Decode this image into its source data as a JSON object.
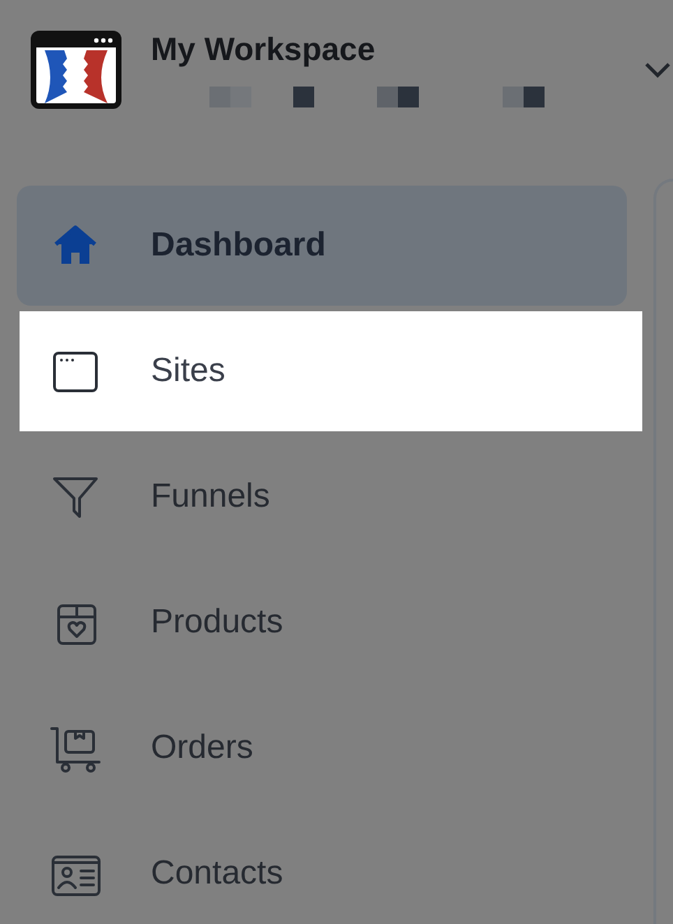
{
  "workspace": {
    "title": "My Workspace"
  },
  "nav": [
    {
      "label": "Dashboard",
      "selected": true,
      "highlighted": false
    },
    {
      "label": "Sites",
      "selected": false,
      "highlighted": true
    },
    {
      "label": "Funnels",
      "selected": false,
      "highlighted": false
    },
    {
      "label": "Products",
      "selected": false,
      "highlighted": false
    },
    {
      "label": "Orders",
      "selected": false,
      "highlighted": false
    },
    {
      "label": "Contacts",
      "selected": false,
      "highlighted": false
    }
  ]
}
